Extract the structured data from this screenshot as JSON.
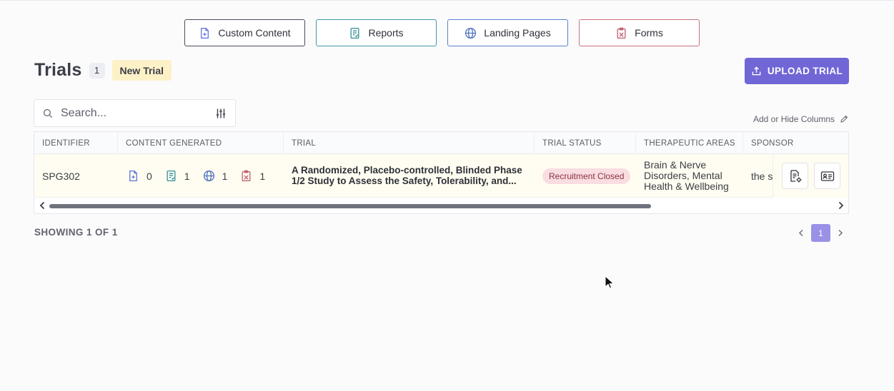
{
  "tabs": [
    {
      "label": "Custom Content",
      "icon": "file-plus-icon"
    },
    {
      "label": "Reports",
      "icon": "report-icon"
    },
    {
      "label": "Landing Pages",
      "icon": "globe-icon"
    },
    {
      "label": "Forms",
      "icon": "clipboard-icon"
    }
  ],
  "header": {
    "title": "Trials",
    "count": "1",
    "new_badge": "New Trial",
    "upload_label": "UPLOAD TRIAL"
  },
  "search": {
    "placeholder": "Search...",
    "value": ""
  },
  "columns_link": "Add or Hide Columns",
  "table": {
    "columns": [
      "IDENTIFIER",
      "CONTENT GENERATED",
      "TRIAL",
      "TRIAL STATUS",
      "THERAPEUTIC AREAS",
      "SPONSOR"
    ],
    "rows": [
      {
        "identifier": "SPG302",
        "generated": {
          "custom": "0",
          "reports": "1",
          "landing": "1",
          "forms": "1"
        },
        "trial": "A Randomized, Placebo-controlled, Blinded Phase 1/2 Study to Assess the Safety, Tolerability, and...",
        "status": "Recruitment Closed",
        "areas": "Brain & Nerve Disorders, Mental Health & Wellbeing",
        "sponsor": "the st"
      }
    ]
  },
  "footer": {
    "showing": "SHOWING 1 OF 1",
    "current_page": "1"
  },
  "colors": {
    "accent": "#7066d6",
    "page_active": "#9a91e6",
    "status_bg": "#f9dde0",
    "badge_yellow": "#fdf1c7",
    "reports_border": "#3c9aa3",
    "landing_border": "#5880c9",
    "forms_border": "#c8707e"
  }
}
